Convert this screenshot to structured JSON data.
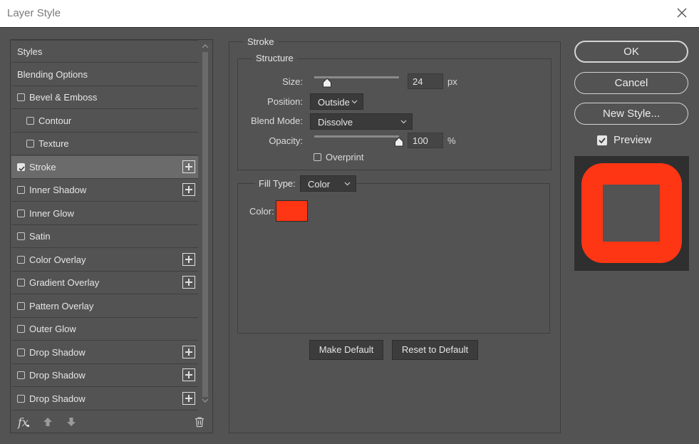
{
  "window": {
    "title": "Layer Style"
  },
  "styles_list": {
    "items": [
      {
        "label": "Styles",
        "checkbox": false,
        "checked": false,
        "plus": false,
        "indent": false,
        "selected": false
      },
      {
        "label": "Blending Options",
        "checkbox": false,
        "checked": false,
        "plus": false,
        "indent": false,
        "selected": false
      },
      {
        "label": "Bevel & Emboss",
        "checkbox": true,
        "checked": false,
        "plus": false,
        "indent": false,
        "selected": false
      },
      {
        "label": "Contour",
        "checkbox": true,
        "checked": false,
        "plus": false,
        "indent": true,
        "selected": false
      },
      {
        "label": "Texture",
        "checkbox": true,
        "checked": false,
        "plus": false,
        "indent": true,
        "selected": false
      },
      {
        "label": "Stroke",
        "checkbox": true,
        "checked": true,
        "plus": true,
        "indent": false,
        "selected": true
      },
      {
        "label": "Inner Shadow",
        "checkbox": true,
        "checked": false,
        "plus": true,
        "indent": false,
        "selected": false
      },
      {
        "label": "Inner Glow",
        "checkbox": true,
        "checked": false,
        "plus": false,
        "indent": false,
        "selected": false
      },
      {
        "label": "Satin",
        "checkbox": true,
        "checked": false,
        "plus": false,
        "indent": false,
        "selected": false
      },
      {
        "label": "Color Overlay",
        "checkbox": true,
        "checked": false,
        "plus": true,
        "indent": false,
        "selected": false
      },
      {
        "label": "Gradient Overlay",
        "checkbox": true,
        "checked": false,
        "plus": true,
        "indent": false,
        "selected": false
      },
      {
        "label": "Pattern Overlay",
        "checkbox": true,
        "checked": false,
        "plus": false,
        "indent": false,
        "selected": false
      },
      {
        "label": "Outer Glow",
        "checkbox": true,
        "checked": false,
        "plus": false,
        "indent": false,
        "selected": false
      },
      {
        "label": "Drop Shadow",
        "checkbox": true,
        "checked": false,
        "plus": true,
        "indent": false,
        "selected": false
      },
      {
        "label": "Drop Shadow",
        "checkbox": true,
        "checked": false,
        "plus": true,
        "indent": false,
        "selected": false
      },
      {
        "label": "Drop Shadow",
        "checkbox": true,
        "checked": false,
        "plus": true,
        "indent": false,
        "selected": false
      }
    ],
    "toolbar": {
      "fx_label": "fx"
    }
  },
  "stroke": {
    "section_title": "Stroke",
    "structure": {
      "title": "Structure",
      "size": {
        "label": "Size:",
        "value": "24",
        "unit": "px"
      },
      "position": {
        "label": "Position:",
        "value": "Outside"
      },
      "blend_mode": {
        "label": "Blend Mode:",
        "value": "Dissolve"
      },
      "opacity": {
        "label": "Opacity:",
        "value": "100",
        "unit": "%"
      },
      "overprint": {
        "label": "Overprint",
        "checked": false
      }
    },
    "fill": {
      "fill_type_label": "Fill Type:",
      "fill_type_value": "Color",
      "color_label": "Color:",
      "color": "#ff3614"
    },
    "make_default_label": "Make Default",
    "reset_default_label": "Reset to Default"
  },
  "actions": {
    "ok_label": "OK",
    "cancel_label": "Cancel",
    "new_style_label": "New Style...",
    "preview_label": "Preview",
    "preview_checked": true
  },
  "preview": {
    "stroke_color": "#ff3614",
    "fill_color": "#535353"
  }
}
